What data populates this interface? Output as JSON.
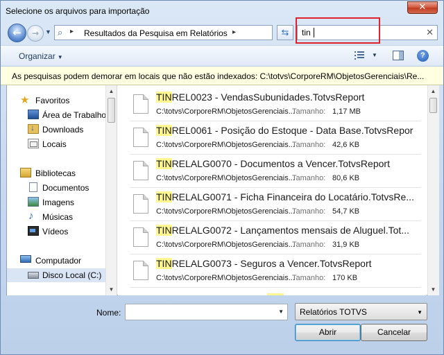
{
  "window": {
    "title": "Selecione os arquivos para importação",
    "close_glyph": "✕"
  },
  "nav": {
    "back_glyph": "←",
    "forward_glyph": "→",
    "address_text": "Resultados da Pesquisa em Relatórios",
    "search_value": "tin"
  },
  "toolbar": {
    "organize_label": "Organizar"
  },
  "infobar": {
    "text": "As pesquisas podem demorar em locais que não estão indexados: C:\\totvs\\CorporeRM\\ObjetosGerenciais\\Re..."
  },
  "sidebar": {
    "favorites": {
      "label": "Favoritos",
      "items": [
        {
          "label": "Área de Trabalho"
        },
        {
          "label": "Downloads"
        },
        {
          "label": "Locais"
        }
      ]
    },
    "libraries": {
      "label": "Bibliotecas",
      "items": [
        {
          "label": "Documentos"
        },
        {
          "label": "Imagens"
        },
        {
          "label": "Músicas"
        },
        {
          "label": "Vídeos"
        }
      ]
    },
    "computer": {
      "label": "Computador",
      "items": [
        {
          "label": "Disco Local (C:)"
        }
      ]
    }
  },
  "results": {
    "size_label": "Tamanho:",
    "items": [
      {
        "match": "TIN",
        "rest": "REL0023 - VendasSubunidades.TotvsReport",
        "path": "C:\\totvs\\CorporeRM\\ObjetosGerenciais...",
        "size": "1,17 MB"
      },
      {
        "match": "TIN",
        "rest": "REL0061 - Posição do Estoque - Data Base.TotvsRepor",
        "path": "C:\\totvs\\CorporeRM\\ObjetosGerenciais...",
        "size": "42,6 KB"
      },
      {
        "match": "TIN",
        "rest": "RELALG0070 - Documentos a Vencer.TotvsReport",
        "path": "C:\\totvs\\CorporeRM\\ObjetosGerenciais...",
        "size": "80,6 KB"
      },
      {
        "match": "TIN",
        "rest": "RELALG0071 - Ficha Financeira do Locatário.TotvsRe...",
        "path": "C:\\totvs\\CorporeRM\\ObjetosGerenciais...",
        "size": "54,7 KB"
      },
      {
        "match": "TIN",
        "rest": "RELALG0072 - Lançamentos mensais de Aluguel.Tot...",
        "path": "C:\\totvs\\CorporeRM\\ObjetosGerenciais...",
        "size": "31,9 KB"
      },
      {
        "match": "TIN",
        "rest": "RELALG0073 - Seguros a Vencer.TotvsReport",
        "path": "C:\\totvs\\CorporeRM\\ObjetosGerenciais...",
        "size": "170 KB"
      }
    ]
  },
  "footer": {
    "name_label": "Nome:",
    "name_value": "",
    "filter_value": "Relatórios TOTVS",
    "open_label": "Abrir",
    "cancel_label": "Cancelar"
  },
  "colors": {
    "highlight": "#fff68f",
    "annotation": "#e0202a",
    "infobar": "#ffffe1"
  }
}
